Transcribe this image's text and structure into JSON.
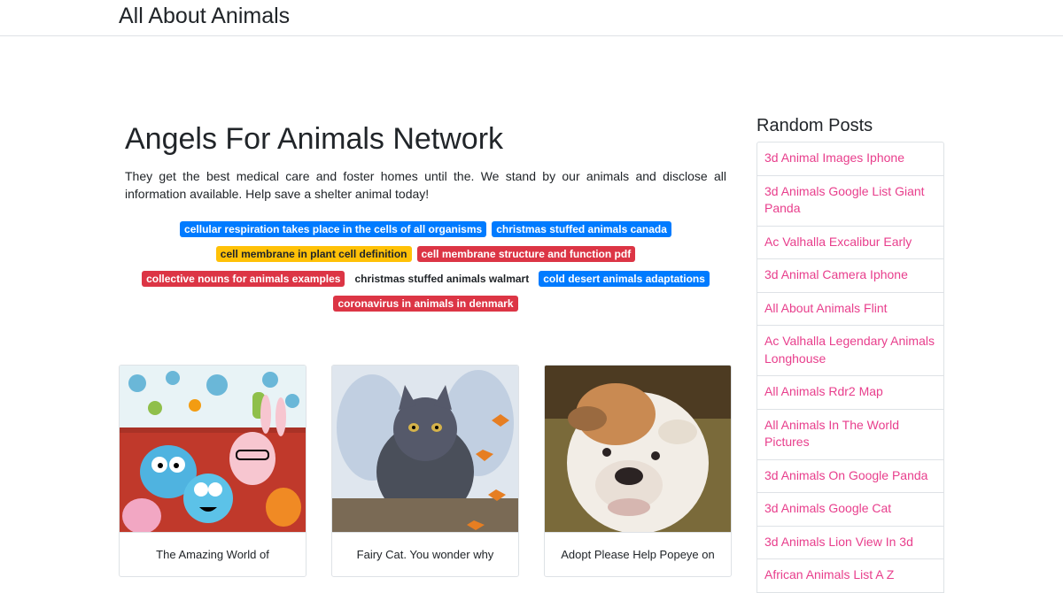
{
  "site": {
    "brand": "All About Animals"
  },
  "main": {
    "title": "Angels For Animals Network",
    "intro": "They get the best medical care and foster homes until the. We stand by our animals and disclose all information available. Help save a shelter animal today!",
    "tags": [
      {
        "label": "cellular respiration takes place in the cells of all organisms",
        "style": "primary"
      },
      {
        "label": "christmas stuffed animals canada",
        "style": "primary"
      },
      {
        "label": "cell membrane in plant cell definition",
        "style": "warning"
      },
      {
        "label": "cell membrane structure and function pdf",
        "style": "danger"
      },
      {
        "label": "collective nouns for animals examples",
        "style": "danger"
      },
      {
        "label": "christmas stuffed animals walmart",
        "style": "light"
      },
      {
        "label": "cold desert animals adaptations",
        "style": "primary"
      },
      {
        "label": "coronavirus in animals in denmark",
        "style": "danger"
      }
    ],
    "cards": [
      {
        "caption": "The Amazing World of",
        "image": "cartoon-illustration"
      },
      {
        "caption": "Fairy Cat. You wonder why",
        "image": "fairy-cat-painting"
      },
      {
        "caption": "Adopt Please Help Popeye on",
        "image": "bulldog-photo"
      }
    ]
  },
  "sidebar": {
    "title": "Random Posts",
    "posts": [
      "3d Animal Images Iphone",
      "3d Animals Google List Giant Panda",
      "Ac Valhalla Excalibur Early",
      "3d Animal Camera Iphone",
      "All About Animals Flint",
      "Ac Valhalla Legendary Animals Longhouse",
      "All Animals Rdr2 Map",
      "All Animals In The World Pictures",
      "3d Animals On Google Panda",
      "3d Animals Google Cat",
      "3d Animals Lion View In 3d",
      "African Animals List A Z"
    ]
  },
  "colors": {
    "primary": "#007bff",
    "warning": "#ffc107",
    "danger": "#dc3545",
    "link": "#e83e8c",
    "border": "#dee2e6",
    "text": "#212529"
  }
}
